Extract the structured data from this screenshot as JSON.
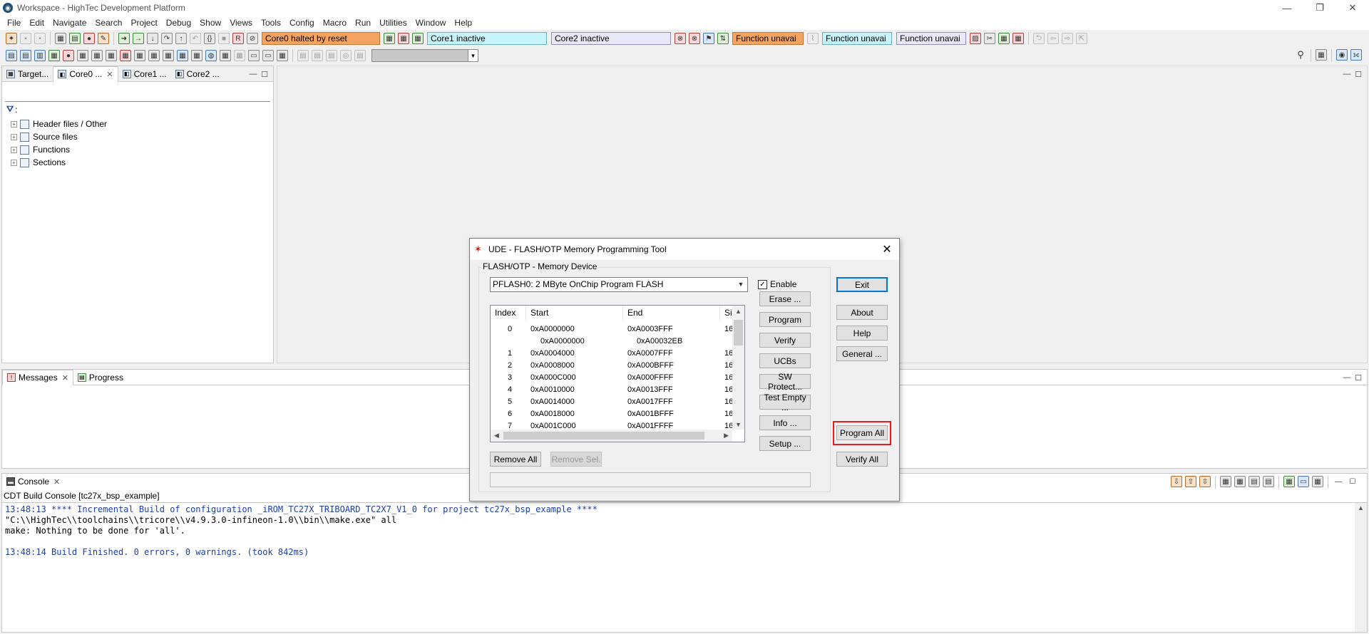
{
  "window": {
    "title": "Workspace - HighTec Development Platform",
    "app_icon": "hightec-logo-icon",
    "controls": [
      "minimize-icon",
      "restore-icon",
      "close-icon"
    ]
  },
  "menu": [
    "File",
    "Edit",
    "Navigate",
    "Search",
    "Project",
    "Debug",
    "Show",
    "Views",
    "Tools",
    "Config",
    "Macro",
    "Run",
    "Utilities",
    "Window",
    "Help"
  ],
  "toolbar": {
    "core0_status": "Core0 halted by reset",
    "core1_status": "Core1 inactive",
    "core2_status": "Core2 inactive",
    "func_status_1": "Function unavai",
    "func_status_2": "Function unavai",
    "func_status_3": "Function unavai"
  },
  "left_panel": {
    "tabs": [
      "Target...",
      "Core0 ...",
      "Core1 ...",
      "Core2 ..."
    ],
    "filter_label": ":",
    "tree": [
      "Header files / Other",
      "Source files",
      "Functions",
      "Sections"
    ]
  },
  "messages_panel": {
    "tabs": [
      "Messages",
      "Progress"
    ]
  },
  "console": {
    "tab": "Console",
    "subtitle": "CDT Build Console [tc27x_bsp_example]",
    "lines": [
      "13:48:13 **** Incremental Build of configuration _iROM_TC27X_TRIBOARD_TC2X7_V1_0 for project tc27x_bsp_example ****",
      "\"C:\\\\HighTec\\\\toolchains\\\\tricore\\\\v4.9.3.0-infineon-1.0\\\\bin\\\\make.exe\" all",
      "make: Nothing to be done for 'all'.",
      "",
      "13:48:14 Build Finished. 0 errors, 0 warnings. (took 842ms)"
    ]
  },
  "dialog": {
    "title": "UDE - FLASH/OTP Memory Programming Tool",
    "group_label": "FLASH/OTP - Memory Device",
    "device": "PFLASH0: 2 MByte OnChip Program FLASH",
    "enable_label": "Enable",
    "enable_checked": true,
    "columns": [
      "Index",
      "Start",
      "End",
      "Siz"
    ],
    "rows": [
      {
        "index": "0",
        "start": "0xA0000000",
        "end": "0xA0003FFF",
        "size": "16"
      },
      {
        "index": "",
        "start": "0xA0000000",
        "end": "0xA00032EB",
        "size": ""
      },
      {
        "index": "1",
        "start": "0xA0004000",
        "end": "0xA0007FFF",
        "size": "16"
      },
      {
        "index": "2",
        "start": "0xA0008000",
        "end": "0xA000BFFF",
        "size": "16"
      },
      {
        "index": "3",
        "start": "0xA000C000",
        "end": "0xA000FFFF",
        "size": "16"
      },
      {
        "index": "4",
        "start": "0xA0010000",
        "end": "0xA0013FFF",
        "size": "16"
      },
      {
        "index": "5",
        "start": "0xA0014000",
        "end": "0xA0017FFF",
        "size": "16"
      },
      {
        "index": "6",
        "start": "0xA0018000",
        "end": "0xA001BFFF",
        "size": "16"
      },
      {
        "index": "7",
        "start": "0xA001C000",
        "end": "0xA001FFFF",
        "size": "16"
      }
    ],
    "buttons_mid": [
      "Erase ...",
      "Program",
      "Verify",
      "UCBs",
      "SW Protect...",
      "Test Empty ...",
      "Info ...",
      "Setup ..."
    ],
    "buttons_right": [
      "Exit",
      "About",
      "Help",
      "General ..."
    ],
    "program_all": "Program All",
    "verify_all": "Verify All",
    "remove_all": "Remove All",
    "remove_sel": "Remove Sel."
  }
}
